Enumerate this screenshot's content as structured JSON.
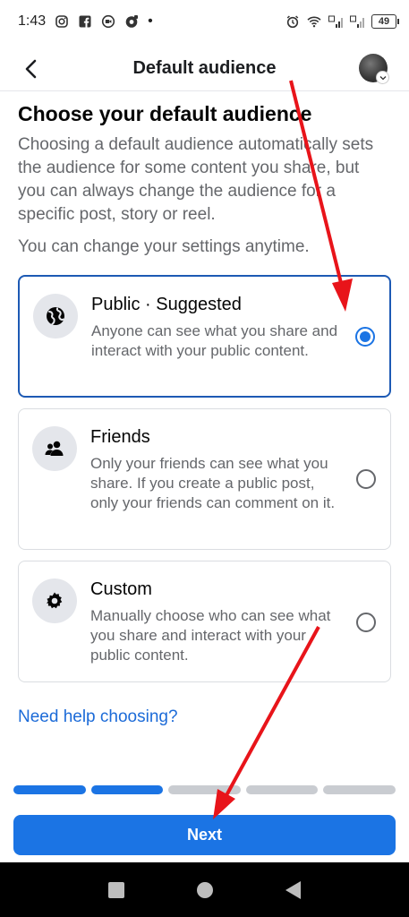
{
  "status_bar": {
    "time": "1:43",
    "dot": "•",
    "battery": "49"
  },
  "header": {
    "title": "Default audience",
    "back_icon": "back-arrow-icon"
  },
  "intro": {
    "title": "Choose your default audience",
    "description": "Choosing a default audience automatically sets the audience for some content you share, but you can always change the audience for a specific post, story or reel.",
    "note": "You can change your settings anytime."
  },
  "options": [
    {
      "title": "Public · Suggested",
      "description": "Anyone can see what you share and interact with your public content.",
      "icon": "globe-icon",
      "selected": true
    },
    {
      "title": "Friends",
      "description": "Only your friends can see what you share. If you create a public post, only your friends can comment on it.",
      "icon": "friends-icon",
      "selected": false
    },
    {
      "title": "Custom",
      "description": "Manually choose who can see what you share and interact with your public content.",
      "icon": "gear-icon",
      "selected": false
    }
  ],
  "help_link": "Need help choosing?",
  "progress": {
    "total_steps": 5,
    "completed_steps": 2
  },
  "next_button": "Next",
  "colors": {
    "accent": "#1b74e4",
    "selected_border": "#1d5ab4",
    "link": "#1c6bd8",
    "annotation": "#e8141a"
  }
}
